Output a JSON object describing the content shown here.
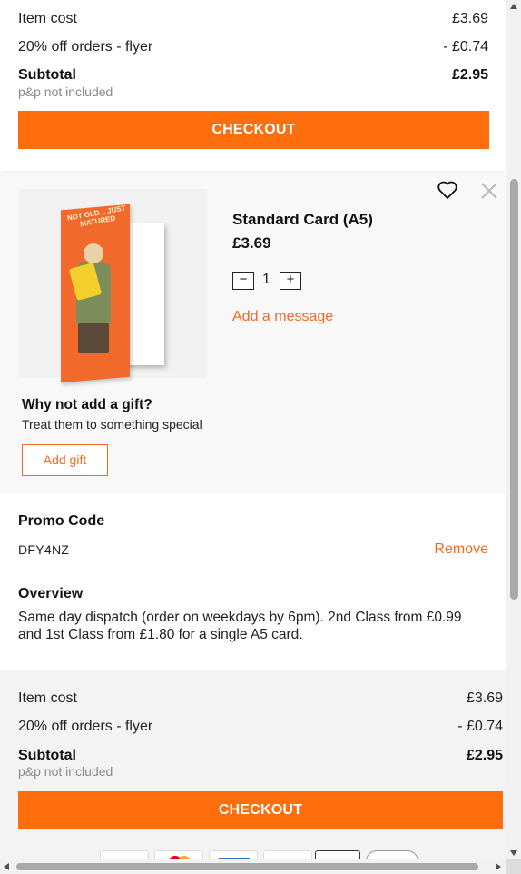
{
  "summary_top": {
    "item_cost_label": "Item cost",
    "item_cost_value": "£3.69",
    "discount_label": "20% off orders - flyer",
    "discount_value": "- £0.74",
    "subtotal_label": "Subtotal",
    "subtotal_value": "£2.95",
    "pp_note": "p&p not included",
    "checkout_label": "CHECKOUT"
  },
  "product": {
    "title": "Standard Card (A5)",
    "price": "£3.69",
    "qty_minus": "−",
    "qty_value": "1",
    "qty_plus": "+",
    "add_message": "Add a message",
    "card_text": "NOT OLD... JUST MATURED",
    "icons": {
      "favorite": "heart-icon",
      "remove": "close-icon"
    }
  },
  "gift": {
    "title": "Why not add a gift?",
    "subtitle": "Treat them to something special",
    "button": "Add gift"
  },
  "promo": {
    "title": "Promo Code",
    "code": "DFY4NZ",
    "remove": "Remove"
  },
  "overview": {
    "title": "Overview",
    "text": "Same day dispatch (order on weekdays by 6pm). 2nd Class from £0.99 and 1st Class from £1.80 for a single A5 card."
  },
  "summary_bottom": {
    "item_cost_label": "Item cost",
    "item_cost_value": "£3.69",
    "discount_label": "20% off orders - flyer",
    "discount_value": "- £0.74",
    "subtotal_label": "Subtotal",
    "subtotal_value": "£2.95",
    "pp_note": "p&p not included",
    "checkout_label": "CHECKOUT"
  },
  "colors": {
    "accent": "#fe6e0c",
    "link": "#f26a21"
  }
}
